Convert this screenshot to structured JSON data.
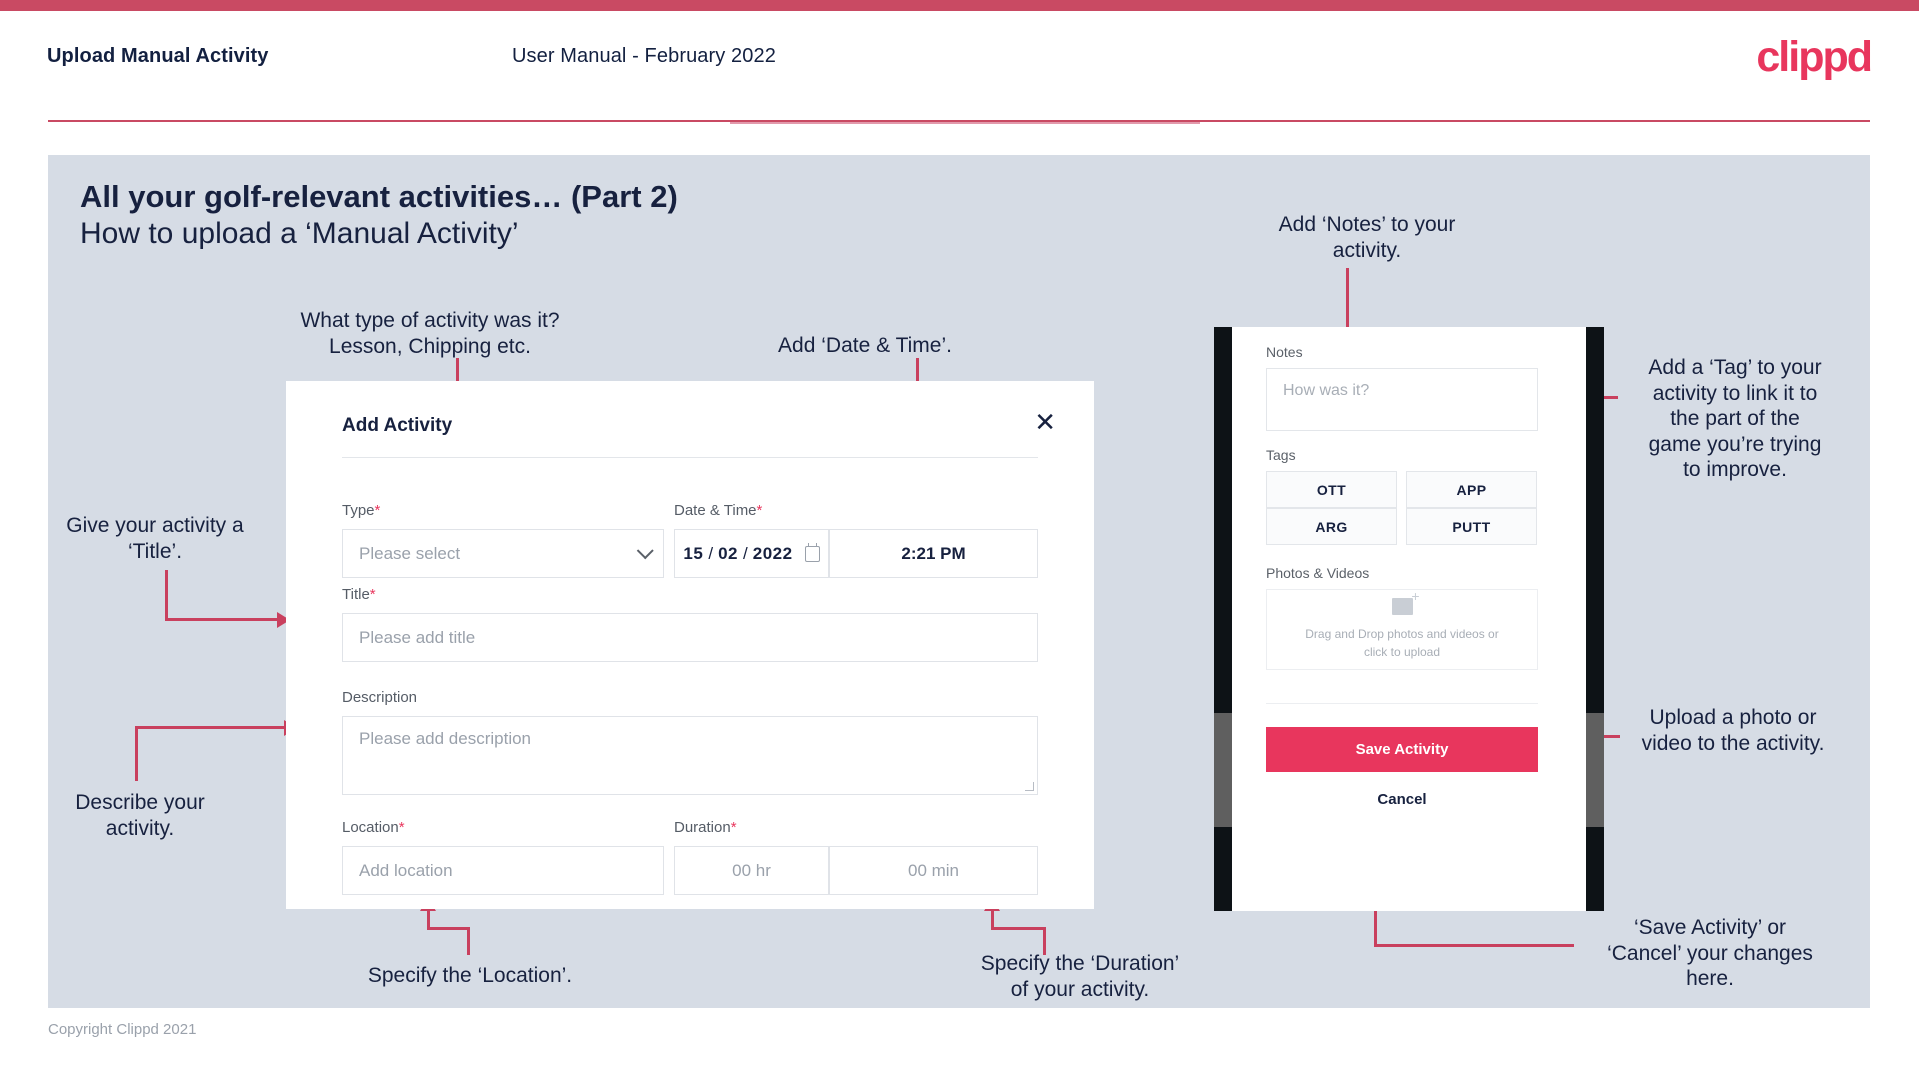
{
  "header": {
    "title": "Upload Manual Activity",
    "subtitle": "User Manual - February 2022",
    "logo": "clippd"
  },
  "slide": {
    "heading": "All your golf-relevant activities… (Part 2)",
    "subheading": "How to upload a ‘Manual Activity’"
  },
  "annotations": {
    "type": "What type of activity was it?\nLesson, Chipping etc.",
    "datetime": "Add ‘Date & Time’.",
    "title": "Give your activity a\n‘Title’.",
    "description": "Describe your\nactivity.",
    "location": "Specify the ‘Location’.",
    "duration": "Specify the ‘Duration’\nof your activity.",
    "notes": "Add ‘Notes’ to your\nactivity.",
    "tags": "Add a ‘Tag’ to your\nactivity to link it to\nthe part of the\ngame you’re trying\nto improve.",
    "photos": "Upload a photo or\nvideo to the activity.",
    "save": "‘Save Activity’ or\n‘Cancel’ your changes\nhere."
  },
  "dialog": {
    "title": "Add Activity",
    "close_icon": "close-icon",
    "fields": {
      "type": {
        "label": "Type",
        "required": "*",
        "placeholder": "Please select"
      },
      "datetime": {
        "label": "Date & Time",
        "required": "*",
        "day": "15",
        "month": "02",
        "year": "2022",
        "time": "2:21 PM"
      },
      "title": {
        "label": "Title",
        "required": "*",
        "placeholder": "Please add title"
      },
      "description": {
        "label": "Description",
        "required": "",
        "placeholder": "Please add description"
      },
      "location": {
        "label": "Location",
        "required": "*",
        "placeholder": "Add location"
      },
      "duration": {
        "label": "Duration",
        "required": "*",
        "hours": "00 hr",
        "minutes": "00 min"
      }
    }
  },
  "phone": {
    "notes": {
      "label": "Notes",
      "placeholder": "How was it?"
    },
    "tags": {
      "label": "Tags",
      "items": [
        "OTT",
        "APP",
        "ARG",
        "PUTT"
      ]
    },
    "photos": {
      "label": "Photos & Videos",
      "dropzone_line1": "Drag and Drop photos and videos or",
      "dropzone_line2": "click to upload"
    },
    "save_label": "Save Activity",
    "cancel_label": "Cancel"
  },
  "footer": {
    "copyright": "Copyright Clippd 2021"
  },
  "colors": {
    "accent": "#e8365d",
    "bar": "#c94a63",
    "connector": "#c9405e",
    "slide_bg": "#d6dce5",
    "text_dark": "#17213f"
  }
}
